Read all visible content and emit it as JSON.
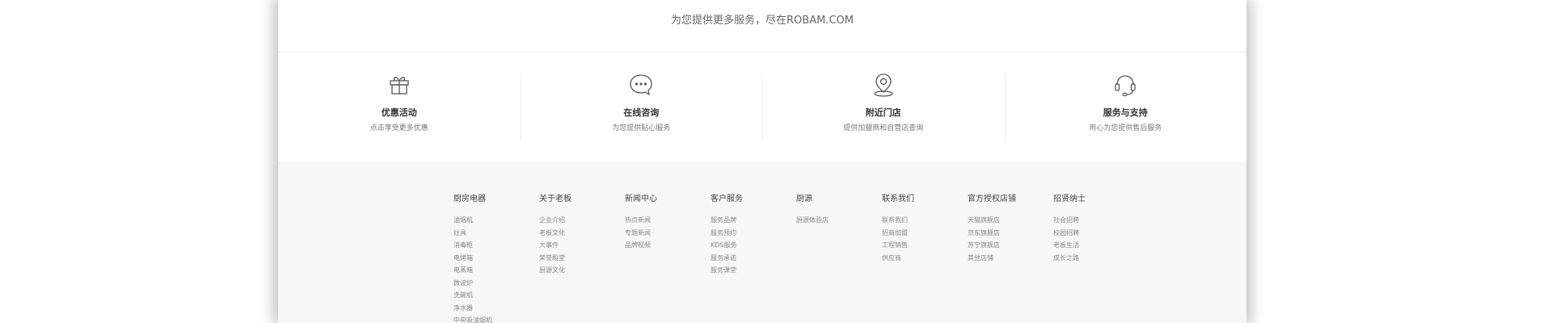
{
  "slogan": "为您提供更多服务，尽在ROBAM.COM",
  "services": [
    {
      "icon": "gift-icon",
      "title": "优惠活动",
      "desc": "点击享受更多优惠"
    },
    {
      "icon": "chat-bubble-icon",
      "title": "在线咨询",
      "desc": "为您提供贴心服务"
    },
    {
      "icon": "location-pin-icon",
      "title": "附近门店",
      "desc": "提供加盟商和自营店查询"
    },
    {
      "icon": "headset-icon",
      "title": "服务与支持",
      "desc": "用心为您提供售后服务"
    }
  ],
  "footer": {
    "columns": [
      {
        "title": "厨房电器",
        "links": [
          "油烟机",
          "灶具",
          "消毒柜",
          "电烤箱",
          "电蒸箱",
          "微波炉",
          "洗碗机",
          "净水器",
          "中央吸油烟机"
        ]
      },
      {
        "title": "关于老板",
        "links": [
          "企业介绍",
          "老板文化",
          "大事件",
          "荣誉殿堂",
          "厨源文化"
        ]
      },
      {
        "title": "新闻中心",
        "links": [
          "热点新闻",
          "专题新闻",
          "品牌视频"
        ]
      },
      {
        "title": "客户服务",
        "links": [
          "服务品牌",
          "服务预约",
          "KDS服务",
          "服务承诺",
          "服务课堂"
        ]
      },
      {
        "title": "厨源",
        "links": [
          "厨源体验店"
        ]
      },
      {
        "title": "联系我们",
        "links": [
          "联系我们",
          "招商加盟",
          "工程销售",
          "供应商"
        ]
      },
      {
        "title": "官方授权店铺",
        "links": [
          "天猫旗舰店",
          "京东旗舰店",
          "苏宁旗舰店",
          "其他店铺"
        ]
      },
      {
        "title": "招贤纳士",
        "links": [
          "社会招聘",
          "校园招聘",
          "老板生活",
          "成长之路"
        ]
      }
    ]
  },
  "colors": {
    "footer_bg": "#f7f7f7",
    "divider": "#ececec",
    "title_text": "#333333",
    "desc_text": "#777777",
    "link_text": "#888888"
  }
}
